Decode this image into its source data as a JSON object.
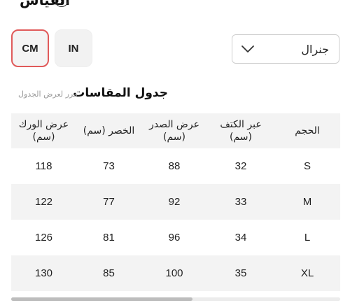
{
  "header": {
    "title": "القياس",
    "help_glyph": "?"
  },
  "units": {
    "cm_label": "CM",
    "in_label": "IN",
    "selected": "CM"
  },
  "fit_select": {
    "value": "جنرال"
  },
  "table": {
    "title": "جدول المقاسات",
    "scroll_hint": "مرر لعرض الجدول",
    "headers": [
      [
        "الحجم"
      ],
      [
        "عبر الكتف",
        "(سم)"
      ],
      [
        "عرض الصدر",
        "(سم)"
      ],
      [
        "الخصر (سم)"
      ],
      [
        "عرض الورك",
        "(سم)"
      ]
    ],
    "rows": [
      [
        "S",
        "32",
        "88",
        "73",
        "118"
      ],
      [
        "M",
        "33",
        "92",
        "77",
        "122"
      ],
      [
        "L",
        "34",
        "96",
        "81",
        "126"
      ],
      [
        "XL",
        "35",
        "100",
        "85",
        "130"
      ]
    ]
  },
  "scrollbar": {
    "position_fraction": 0.55
  },
  "colors": {
    "selected_border": "#e05a5a",
    "row_shade": "#f3f3f3"
  }
}
